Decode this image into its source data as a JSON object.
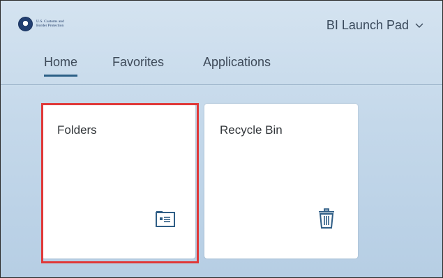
{
  "header": {
    "logo_line1": "U.S. Customs and",
    "logo_line2": "Border Protection",
    "launchpad_label": "BI Launch Pad"
  },
  "tabs": [
    {
      "label": "Home",
      "active": true
    },
    {
      "label": "Favorites",
      "active": false
    },
    {
      "label": "Applications",
      "active": false
    }
  ],
  "tiles": [
    {
      "title": "Folders",
      "icon": "folder-card-icon",
      "highlighted": true
    },
    {
      "title": "Recycle Bin",
      "icon": "trash-icon",
      "highlighted": false
    }
  ],
  "colors": {
    "background_gradient_top": "#d4e3f0",
    "background_gradient_bottom": "#b6cee4",
    "accent_tab_underline": "#2b5f86",
    "highlight_border": "#e03838",
    "icon_color": "#2f5e86"
  }
}
